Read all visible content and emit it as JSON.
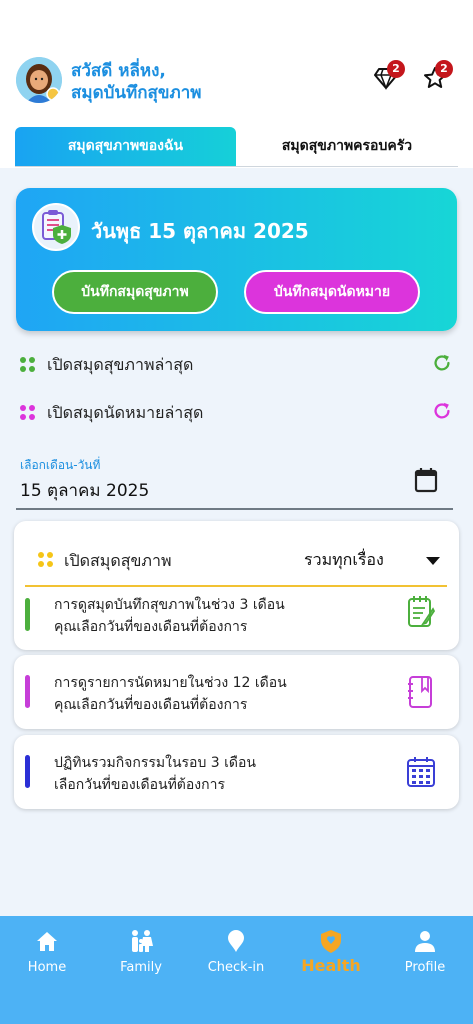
{
  "header": {
    "greeting_line1": "สวัสดี หลี่หง,",
    "greeting_line2": "สมุดบันทึกสุขภาพ",
    "diamond_count": "2",
    "star_count": "2"
  },
  "tabs": [
    {
      "label": "สมุดสุขภาพของฉัน",
      "active": true
    },
    {
      "label": "สมุดสุขภาพครอบครัว",
      "active": false
    }
  ],
  "card": {
    "date_title": "วันพุธ 15 ตุลาคม 2025",
    "button_health": "บันทึกสมุดสุขภาพ",
    "button_appointment": "บันทึกสมุดนัดหมาย"
  },
  "quick_links": {
    "latest_health": "เปิดสมุดสุขภาพล่าสุด",
    "latest_appointment": "เปิดสมุดนัดหมายล่าสุด"
  },
  "date_field": {
    "label": "เลือกเดือน-วันที่",
    "value": "15 ตุลาคม 2025"
  },
  "select_panel": {
    "label": "เปิดสมุดสุขภาพ",
    "value": "รวมทุกเรื่อง",
    "item_line1": "การดูสมุดบันทึกสุขภาพในช่วง 3 เดือน",
    "item_line2": "คุณเลือกวันที่ของเดือนที่ต้องการ"
  },
  "appointment_panel": {
    "line1": "การดูรายการนัดหมายในช่วง 12 เดือน",
    "line2": "คุณเลือกวันที่ของเดือนที่ต้องการ"
  },
  "activity_panel": {
    "line1": "ปฏิทินรวมกิจกรรมในรอบ 3 เดือน",
    "line2": "เลือกวันที่ของเดือนที่ต้องการ"
  },
  "nav": [
    {
      "label": "Home",
      "icon": "home-icon"
    },
    {
      "label": "Family",
      "icon": "family-icon"
    },
    {
      "label": "Check-in",
      "icon": "pin-icon"
    },
    {
      "label": "Health",
      "icon": "shield-icon",
      "active": true
    },
    {
      "label": "Profile",
      "icon": "person-icon"
    }
  ],
  "colors": {
    "accent_blue": "#1c8fe0",
    "green": "#4caf3d",
    "magenta": "#dc34dc",
    "nav_bg": "#4db2f5",
    "nav_active": "#f5a623",
    "badge": "#c4161c"
  }
}
